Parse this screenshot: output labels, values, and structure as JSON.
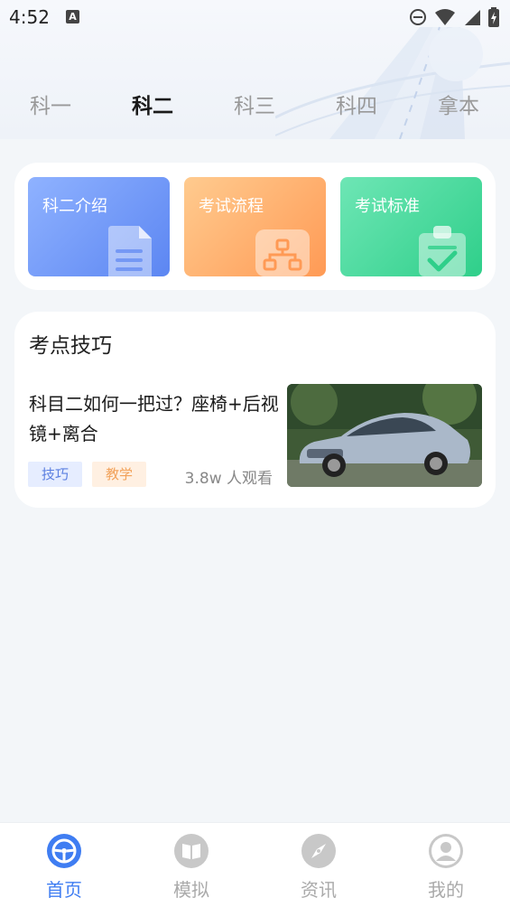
{
  "status_bar": {
    "time": "4:52",
    "a_badge": "A",
    "icons": [
      "dnd-icon",
      "wifi-icon",
      "signal-icon",
      "battery-icon"
    ]
  },
  "tabs": [
    {
      "label": "科一",
      "active": false
    },
    {
      "label": "科二",
      "active": true
    },
    {
      "label": "科三",
      "active": false
    },
    {
      "label": "科四",
      "active": false
    },
    {
      "label": "拿本",
      "active": false
    }
  ],
  "quick_links": [
    {
      "label": "科二介绍",
      "icon": "document-icon",
      "color": "#6b93f7"
    },
    {
      "label": "考试流程",
      "icon": "flowchart-icon",
      "color": "#ffad6b"
    },
    {
      "label": "考试标准",
      "icon": "clipboard-check-icon",
      "color": "#3fd69a"
    }
  ],
  "tips_section": {
    "title": "考点技巧",
    "article": {
      "title": "科目二如何一把过？座椅+后视镜+离合",
      "tags": [
        "技巧",
        "教学"
      ],
      "views": "3.8w 人观看",
      "thumbnail": "silver-sedan-photo"
    }
  },
  "bottom_nav": [
    {
      "label": "首页",
      "icon": "steering-wheel-icon",
      "active": true
    },
    {
      "label": "模拟",
      "icon": "book-icon",
      "active": false
    },
    {
      "label": "资讯",
      "icon": "compass-icon",
      "active": false
    },
    {
      "label": "我的",
      "icon": "user-icon",
      "active": false
    }
  ],
  "colors": {
    "accent": "#3f7df2",
    "background": "#f3f6f9"
  }
}
